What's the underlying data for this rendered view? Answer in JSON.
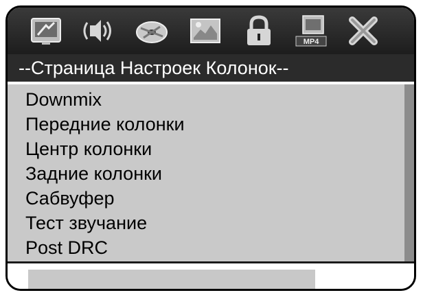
{
  "icon_bar": {
    "icons": [
      {
        "name": "system-setup-icon",
        "selected": false
      },
      {
        "name": "audio-speaker-icon",
        "selected": true
      },
      {
        "name": "video-disc-icon",
        "selected": false
      },
      {
        "name": "picture-setup-icon",
        "selected": false
      },
      {
        "name": "lock-icon",
        "selected": false
      },
      {
        "name": "mp4-film-icon",
        "selected": false,
        "caption": "MP4"
      },
      {
        "name": "exit-x-icon",
        "selected": false
      }
    ]
  },
  "page": {
    "title": "--Страница Настроек Колонок--"
  },
  "menu": {
    "items": [
      "Downmix",
      "Передние колонки",
      "Центр колонки",
      "Задние колонки",
      "Сабвуфер",
      "Тест звучание",
      "Post DRC"
    ]
  },
  "colors": {
    "icon_bar": "#2a2a2a",
    "title_bar": "#2b2b2b",
    "menu_area": "#c9c9c9",
    "scrollbar": "#8c8c8c",
    "status_field": "#c8c8c8"
  }
}
